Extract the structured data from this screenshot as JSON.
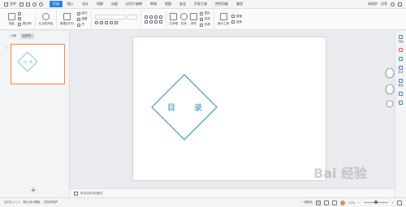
{
  "menubar": {
    "file_label": "文件",
    "tabs": [
      "开始",
      "插入",
      "设计",
      "切换",
      "动画",
      "幻灯片放映",
      "审阅",
      "视图",
      "安全",
      "开发工具",
      "特色功能",
      "查找"
    ],
    "active_tab": "开始",
    "right": {
      "collab_label": "未同步",
      "share_label": "分享"
    }
  },
  "ribbon": {
    "paste_label": "粘贴",
    "format_painter_label": "格式刷",
    "from_current_label": "从当前开始",
    "new_slide_label": "新建幻灯片",
    "layout_label": "版式",
    "reset_label": "重置",
    "section_label": "节",
    "textbox_label": "文本框",
    "shapes_label": "形状",
    "arrange_label": "排列",
    "picture_label": "图片",
    "fill_label": "填充",
    "outline_label": "轮廓",
    "present_label": "演示工具",
    "replace_label": "替换",
    "select_label": "选择"
  },
  "leftpanel": {
    "tabs": [
      "大纲",
      "幻灯片"
    ],
    "active_tab": "幻灯片",
    "slide_number": "1",
    "add_label": "+"
  },
  "slide": {
    "title_chars": [
      "目",
      "录"
    ],
    "diamond_color": "#2b8fb0",
    "thumb_color": "#5bc1c4"
  },
  "notes": {
    "placeholder": "单击此处添加备注"
  },
  "rightbar": {
    "items": [
      {
        "label": "动画",
        "icon": "animation-icon"
      },
      {
        "label": "",
        "icon": "star-icon"
      },
      {
        "label": "",
        "icon": "template-icon"
      },
      {
        "label": "形状",
        "icon": "shape-icon"
      },
      {
        "label": "属性",
        "icon": "property-icon"
      },
      {
        "label": "",
        "icon": "layers-icon"
      },
      {
        "label": "",
        "icon": "settings-icon"
      }
    ]
  },
  "statusbar": {
    "slide_info": "幻灯片 1 / 1",
    "theme": "默认设计模板",
    "doc_status": "文档未保护",
    "arrange_label": "一键美化",
    "zoom": "47%"
  },
  "watermark": "Bai 经验"
}
